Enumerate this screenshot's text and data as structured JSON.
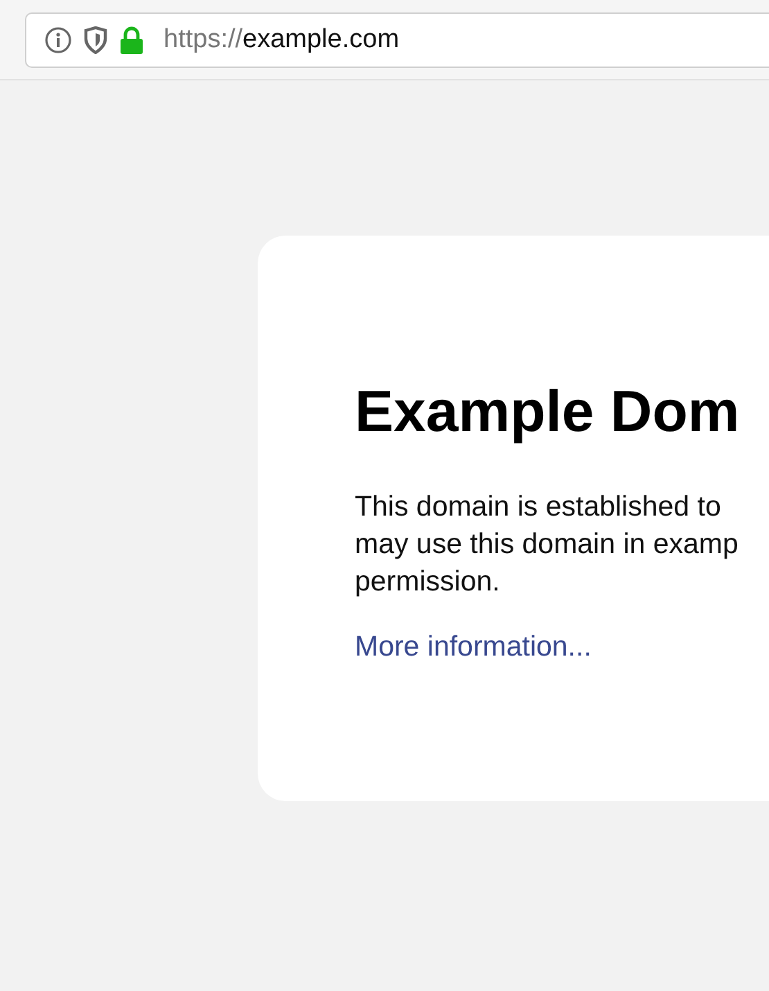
{
  "address_bar": {
    "url_scheme": "https://",
    "url_host": "example.com"
  },
  "page": {
    "heading": "Example Dom",
    "paragraph_lines": [
      "This domain is established to",
      "may use this domain in examp",
      "permission."
    ],
    "link": "More information..."
  }
}
